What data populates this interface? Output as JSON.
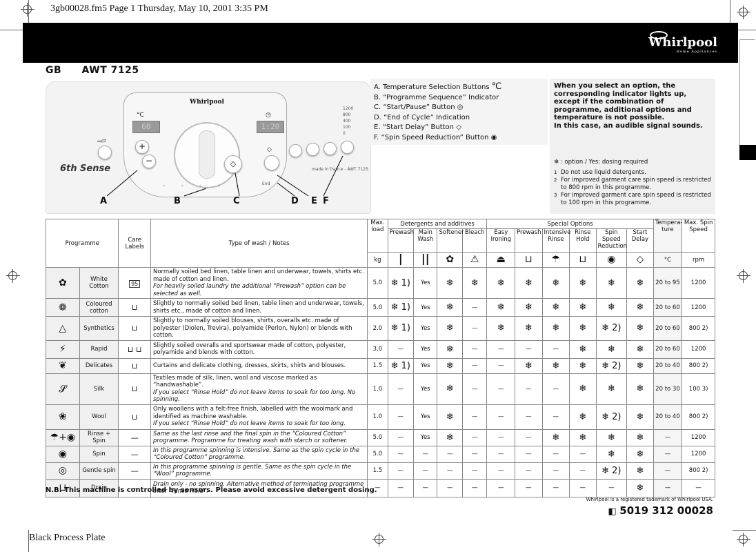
{
  "print_header": "3gb00028.fm5  Page 1  Thursday, May 10, 2001  3:35 PM",
  "brand": {
    "logo": "Whirlpool",
    "tagline": "Home Appliances"
  },
  "model": {
    "country": "GB",
    "name": "AWT 7125"
  },
  "panel": {
    "temp_symbol": "°C",
    "temp_display": "60",
    "time_symbol": "clock",
    "time_display": "1:20",
    "badge": "6th Sense",
    "made_in": "made in france - AWT 7125",
    "spin_levels": [
      "1200",
      "800",
      "400",
      "100",
      "0"
    ],
    "callouts": [
      "A",
      "B",
      "C",
      "D",
      "E",
      "F"
    ]
  },
  "legend": [
    {
      "letter": "A.",
      "text": "Temperature Selection Buttons",
      "icon": "°C"
    },
    {
      "letter": "B.",
      "text": "“Programme Sequence” Indicator",
      "icon": ""
    },
    {
      "letter": "C.",
      "text": "“Start/Pause” Button",
      "icon": "start-pause-icon"
    },
    {
      "letter": "D.",
      "text": "“End of Cycle” Indication",
      "icon": ""
    },
    {
      "letter": "E.",
      "text": "“Start Delay” Button",
      "icon": "start-delay-icon"
    },
    {
      "letter": "F.",
      "text": "“Spin Speed Reduction” Button",
      "icon": "spin-icon"
    }
  ],
  "info": {
    "text": "When you select an option, the corresponding indicator lights up, except if the combination of programme, additional options and temperature is not possible.",
    "text2": "In this case, an audible signal sounds.",
    "option_key": "❄ : option / Yes: dosing required",
    "notes": [
      {
        "num": "1",
        "text": "Do not use liquid detergents."
      },
      {
        "num": "2",
        "text": "For improved garment care spin speed is restricted to 800 rpm in this programme."
      },
      {
        "num": "3",
        "text": "For improved garment care spin speed is restricted to 100 rpm in this programme."
      }
    ]
  },
  "table": {
    "headers": {
      "programme": "Programme",
      "care_labels": "Care Labels",
      "type_of_wash": "Type of wash / Notes",
      "max_load": "Max. load",
      "max_load_unit": "kg",
      "detergents": "Detergents and additives",
      "special": "Special Options",
      "temperature": "Tempera-ture",
      "temperature_unit": "°C",
      "max_spin": "Max. Spin Speed",
      "max_spin_unit": "rpm",
      "det_cols": [
        "Prewash",
        "Main Wash",
        "Softener",
        "Bleach"
      ],
      "det_symbols": [
        "|",
        "||",
        "softener-icon",
        "bleach-icon"
      ],
      "special_cols": [
        "Easy Ironing",
        "Prewash",
        "Intensive Rinse",
        "Rinse Hold",
        "Spin Speed Reduction",
        "Start Delay"
      ],
      "special_symbols": [
        "iron-icon",
        "prewash-tub-icon",
        "shower-icon",
        "tub-icon",
        "spin-icon",
        "start-delay-icon"
      ]
    },
    "rows": [
      {
        "icon": "cotton-flower-icon",
        "name": "White Cotton",
        "care": "95",
        "notes": "Normally soiled bed linen, table linen and underwear, towels, shirts etc. made of cotton and linen.",
        "notes_italic": "For heavily soiled laundry the additional “Prewash” option can be selected as well.",
        "load": "5.0",
        "cells": [
          "❄ 1)",
          "Yes",
          "❄",
          "❄",
          "❄",
          "❄",
          "❄",
          "❄",
          "❄",
          "❄"
        ],
        "temp": "20 to 95",
        "spin": "1200"
      },
      {
        "icon": "coloured-cotton-icon",
        "name": "Coloured cotton",
        "care": "tub",
        "notes": "Slightly to normally soiled bed linen, table linen and underwear, towels, shirts etc., made of cotton and linen.",
        "notes_italic": "",
        "load": "5.0",
        "cells": [
          "❄ 1)",
          "Yes",
          "❄",
          "—",
          "❄",
          "❄",
          "❄",
          "❄",
          "❄",
          "❄"
        ],
        "temp": "20 to 60",
        "spin": "1200"
      },
      {
        "icon": "synthetics-icon",
        "name": "Synthetics",
        "care": "tub-bar",
        "notes": "Slightly to normally soiled blouses, shirts, overalls etc. made of polyester (Diolen, Trevira), polyamide (Perlon, Nylon) or blends with cotton.",
        "notes_italic": "",
        "load": "2.0",
        "cells": [
          "❄ 1)",
          "Yes",
          "❄",
          "—",
          "❄",
          "❄",
          "❄",
          "❄",
          "❄ 2)",
          "❄"
        ],
        "temp": "20 to 60",
        "spin": "800 2)"
      },
      {
        "icon": "rapid-icon",
        "name": "Rapid",
        "care": "tub tub-bar",
        "notes": "Slightly soiled overalls and sportswear made of cotton, polyester, polyamide and blends with cotton.",
        "notes_italic": "",
        "load": "3.0",
        "cells": [
          "—",
          "Yes",
          "❄",
          "—",
          "—",
          "—",
          "—",
          "❄",
          "❄",
          "❄"
        ],
        "temp": "20 to 60",
        "spin": "1200"
      },
      {
        "icon": "delicates-icon",
        "name": "Delicates",
        "care": "tub-double-bar",
        "notes": "Curtains and delicate clothing, dresses, skirts, shirts and blouses.",
        "notes_italic": "",
        "load": "1.5",
        "cells": [
          "❄ 1)",
          "Yes",
          "❄",
          "—",
          "—",
          "❄",
          "❄",
          "❄",
          "❄ 2)",
          "❄"
        ],
        "temp": "20 to 40",
        "spin": "800 2)"
      },
      {
        "icon": "silk-icon",
        "name": "Silk",
        "care": "silk",
        "notes": "Textiles made of silk, linen, wool and viscose marked as “handwashable”.",
        "notes_italic": "If you select “Rinse Hold” do not leave items to soak for too long. No spinning.",
        "load": "1.0",
        "cells": [
          "—",
          "Yes",
          "❄",
          "—",
          "—",
          "—",
          "—",
          "❄",
          "❄",
          "❄"
        ],
        "temp": "20 to 30",
        "spin": "100 3)"
      },
      {
        "icon": "wool-icon",
        "name": "Wool",
        "care": "wool",
        "notes": "Only woollens with a felt-free finish, labelled with the woolmark and identified as machine washable.",
        "notes_italic": "If you select “Rinse Hold” do not leave items to soak for too long.",
        "load": "1.0",
        "cells": [
          "—",
          "Yes",
          "❄",
          "—",
          "—",
          "—",
          "—",
          "❄",
          "❄ 2)",
          "❄"
        ],
        "temp": "20 to 40",
        "spin": "800 2)"
      },
      {
        "icon": "rinse-spin-icon",
        "name": "Rinse + Spin",
        "care": "—",
        "notes": "",
        "notes_italic": "Same as the last rinse and the final spin in the “Coloured Cotton” programme. Programme for treating wash with starch or softener.",
        "load": "5.0",
        "cells": [
          "—",
          "Yes",
          "❄",
          "—",
          "—",
          "—",
          "❄",
          "❄",
          "❄",
          "❄"
        ],
        "temp": "—",
        "spin": "1200"
      },
      {
        "icon": "spin-icon",
        "name": "Spin",
        "care": "—",
        "notes": "",
        "notes_italic": "In this programme spinning is intensive. Same as the spin cycle in the “Coloured Cotton” programme.",
        "load": "5.0",
        "cells": [
          "—",
          "—",
          "—",
          "—",
          "—",
          "—",
          "—",
          "—",
          "❄",
          "❄"
        ],
        "temp": "—",
        "spin": "1200"
      },
      {
        "icon": "gentle-spin-icon",
        "name": "Gentle spin",
        "care": "—",
        "notes": "",
        "notes_italic": "In this programme spinning is gentle. Same as the spin cycle in the “Wool” programme.",
        "load": "1.5",
        "cells": [
          "—",
          "—",
          "—",
          "—",
          "—",
          "—",
          "—",
          "—",
          "❄ 2)",
          "❄"
        ],
        "temp": "—",
        "spin": "800 2)"
      },
      {
        "icon": "drain-icon",
        "name": "Drain",
        "care": "—",
        "notes": "",
        "notes_italic": "Drain only - no spinning. Alternative method of terminating programme after “Rinse Hold”.",
        "load": "—",
        "cells": [
          "—",
          "—",
          "—",
          "—",
          "—",
          "—",
          "—",
          "—",
          "—",
          "❄"
        ],
        "temp": "—",
        "spin": "—"
      }
    ]
  },
  "footer": {
    "nb": "N.B. This machine is controlled by sensors. Please avoid excessive detergent dosing.",
    "trademark": "Whirlpool is a registered tademark of Whirlpool USA.",
    "part_number": "5019 312 00028",
    "plate": "Black Process Plate"
  }
}
